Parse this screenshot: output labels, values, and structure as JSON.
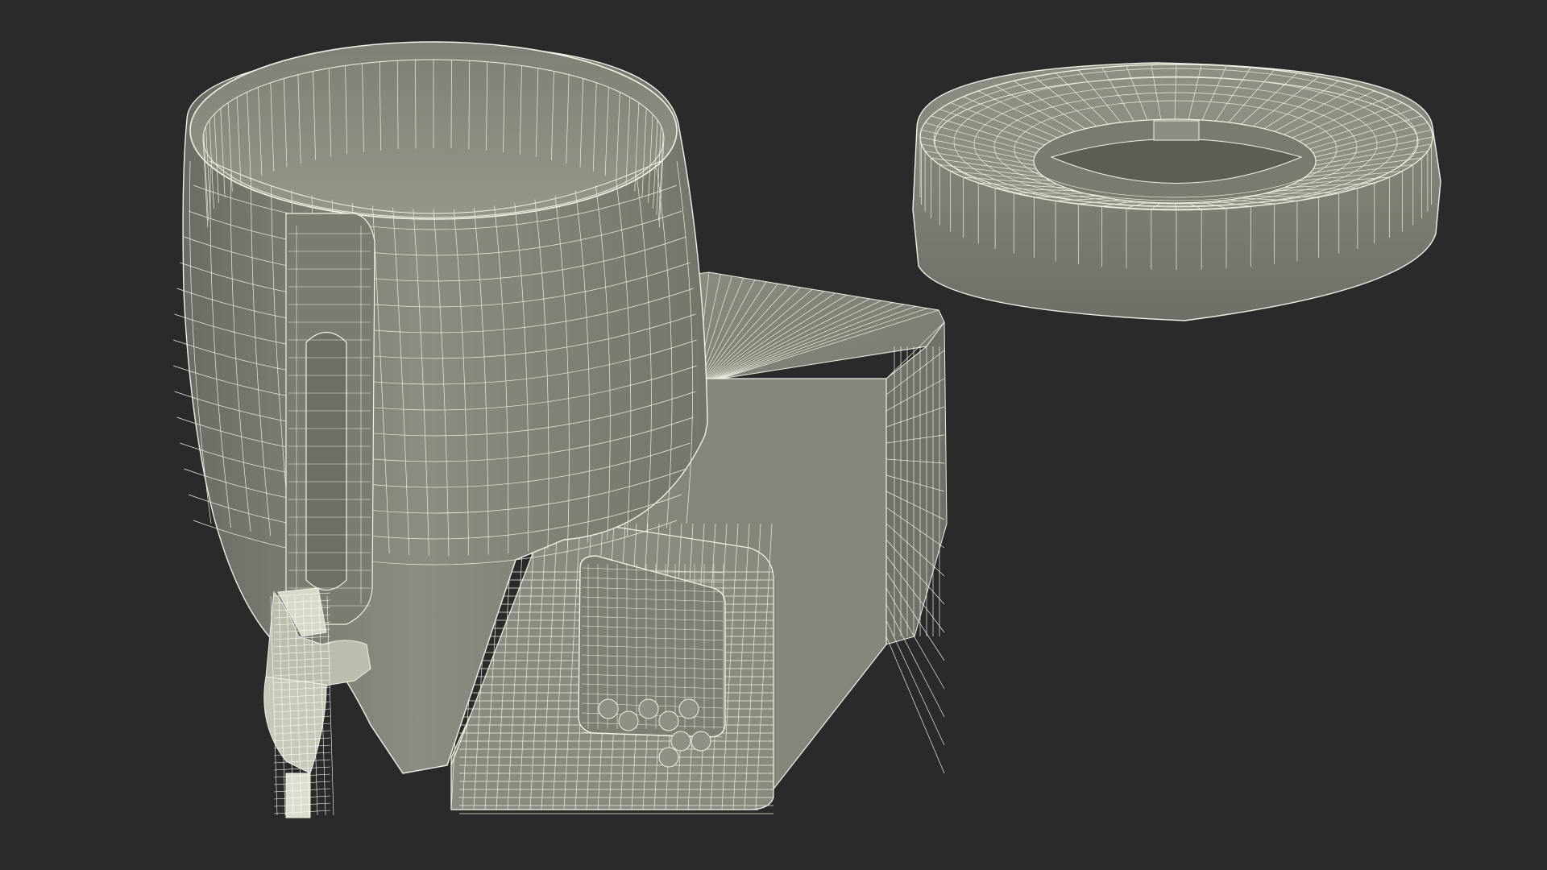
{
  "scene": {
    "background": "#2a2a2a",
    "surface_color": "#84847a",
    "surface_dark": "#63635b",
    "surface_light": "#a3a397",
    "wire_color": "#f1f1e6",
    "objects": [
      "barrel-dispenser",
      "spigot",
      "base-unit",
      "control-panel",
      "lid"
    ]
  }
}
